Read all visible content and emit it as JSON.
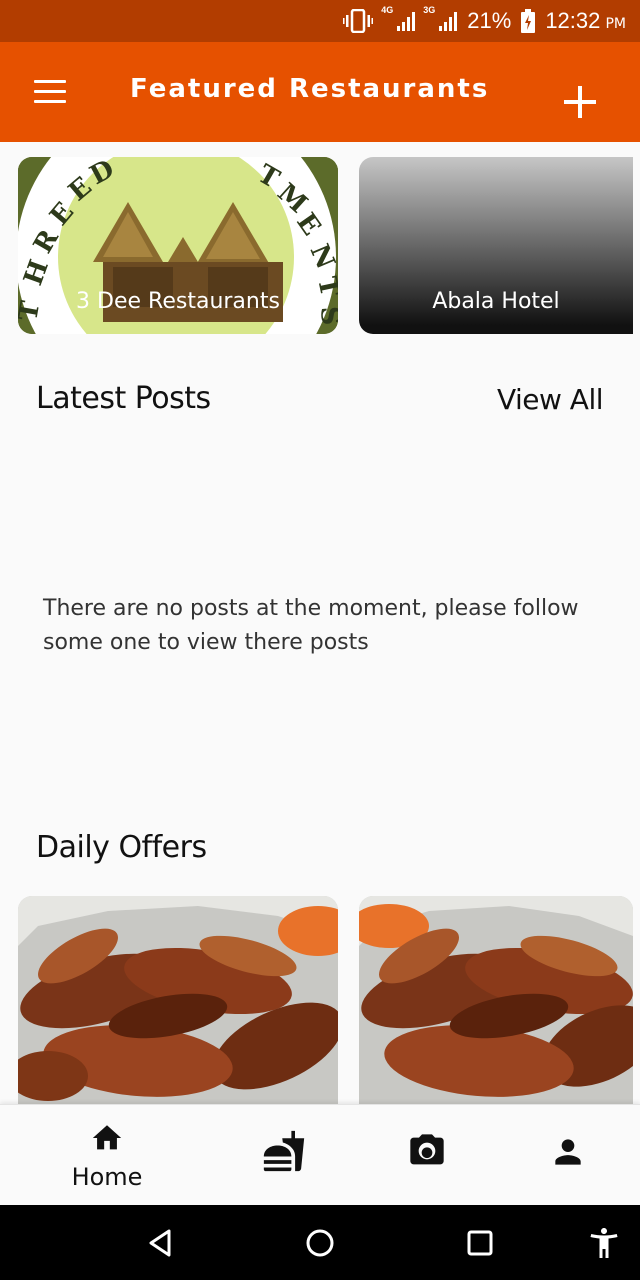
{
  "status_bar": {
    "network_1": "4G",
    "network_2": "3G",
    "battery": "21%",
    "time": "12:32",
    "ampm": "PM"
  },
  "app_bar": {
    "title": "Featured Restaurants",
    "menu_icon": "hamburger-menu-icon",
    "add_icon": "plus-icon"
  },
  "restaurants": [
    {
      "name": "3 Dee Restaurants",
      "logo_text": "THREE DEE APARTMENTS"
    },
    {
      "name": "Abala Hotel"
    }
  ],
  "latest_posts": {
    "title": "Latest Posts",
    "view_all": "View All",
    "empty_message": "There are no posts at the moment, please follow some one to view there posts"
  },
  "daily_offers": {
    "title": "Daily Offers"
  },
  "bottom_nav": {
    "items": [
      {
        "icon": "home-icon",
        "label": "Home"
      },
      {
        "icon": "fastfood-icon",
        "label": ""
      },
      {
        "icon": "camera-icon",
        "label": ""
      },
      {
        "icon": "person-icon",
        "label": ""
      }
    ]
  },
  "colors": {
    "status_bar": "#b23d00",
    "app_bar": "#e65100",
    "background": "#fafafa"
  }
}
